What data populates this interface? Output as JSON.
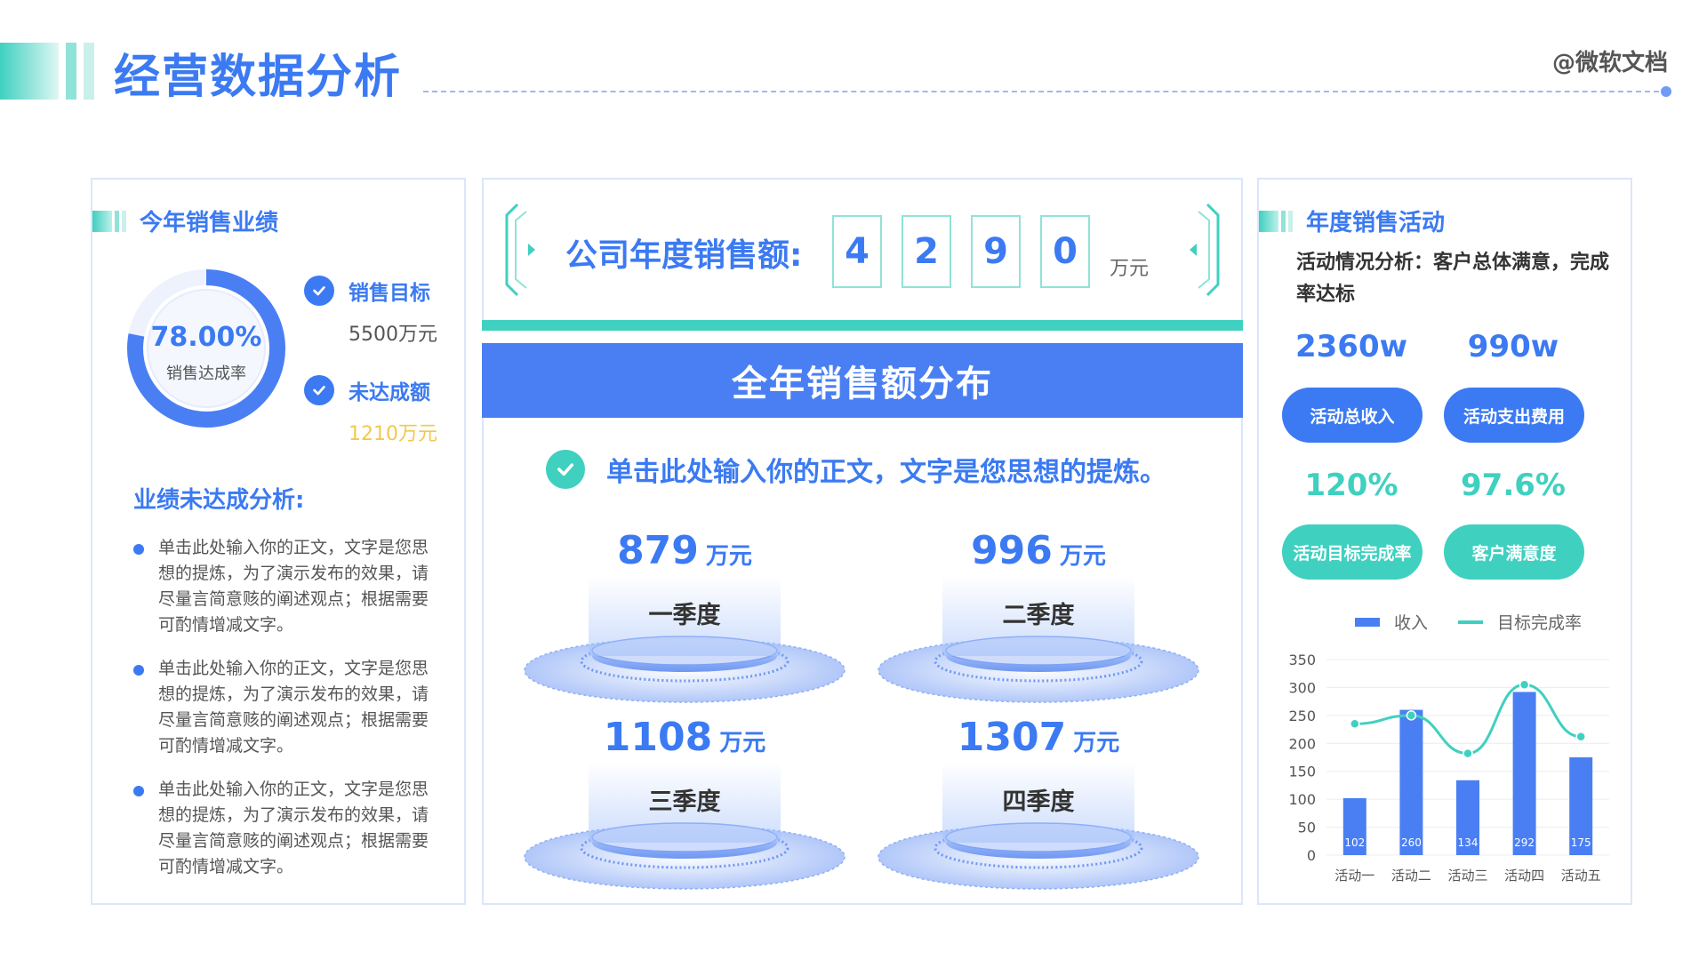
{
  "header": {
    "title": "经营数据分析",
    "brand": "@微软文档"
  },
  "left": {
    "section_title": "今年销售业绩",
    "donut": {
      "value_text": "78.00%",
      "label": "销售达成率",
      "fraction": 0.78
    },
    "kpis": [
      {
        "label": "销售目标",
        "value": "5500万元",
        "color": "#555555"
      },
      {
        "label": "未达成额",
        "value": "1210万元",
        "color": "#f2c94c"
      }
    ],
    "analysis_title": "业绩未达成分析:",
    "bullets": [
      "单击此处输入你的正文，文字是您思想的提炼，为了演示发布的效果，请尽量言简意赅的阐述观点；根据需要可酌情增减文字。",
      "单击此处输入你的正文，文字是您思想的提炼，为了演示发布的效果，请尽量言简意赅的阐述观点；根据需要可酌情增减文字。",
      "单击此处输入你的正文，文字是您思想的提炼，为了演示发布的效果，请尽量言简意赅的阐述观点；根据需要可酌情增减文字。"
    ]
  },
  "center": {
    "sales_label": "公司年度销售额:",
    "digits": [
      "4",
      "2",
      "9",
      "0"
    ],
    "digit_unit": "万元",
    "dist_title": "全年销售额分布",
    "intro": "单击此处输入你的正文，文字是您思想的提炼。",
    "quarters": [
      {
        "value": "879",
        "unit": "万元",
        "name": "一季度"
      },
      {
        "value": "996",
        "unit": "万元",
        "name": "二季度"
      },
      {
        "value": "1108",
        "unit": "万元",
        "name": "三季度"
      },
      {
        "value": "1307",
        "unit": "万元",
        "name": "四季度"
      }
    ]
  },
  "right": {
    "section_title": "年度销售活动",
    "desc": "活动情况分析：客户总体满意，完成率达标",
    "stats": [
      {
        "value": "2360w",
        "label": "活动总收入",
        "color": "#3b7af2"
      },
      {
        "value": "990w",
        "label": "活动支出费用",
        "color": "#3b7af2"
      },
      {
        "value": "120%",
        "label": "活动目标完成率",
        "color": "#3fd0c0"
      },
      {
        "value": "97.6%",
        "label": "客户满意度",
        "color": "#3fd0c0"
      }
    ]
  },
  "colors": {
    "blue": "#3b7af2",
    "bar_blue": "#4a7ff3",
    "teal": "#3fd0c0",
    "pale_blue": "#dbe6fb"
  },
  "chart_data": {
    "type": "bar",
    "categories": [
      "活动一",
      "活动二",
      "活动三",
      "活动四",
      "活动五"
    ],
    "series": [
      {
        "name": "收入",
        "type": "bar",
        "values": [
          102,
          260,
          134,
          292,
          175
        ]
      },
      {
        "name": "目标完成率",
        "type": "line",
        "values": [
          235,
          250,
          182,
          305,
          212
        ]
      }
    ],
    "ylim": [
      0,
      350
    ],
    "yticks": [
      0,
      50,
      100,
      150,
      200,
      250,
      300,
      350
    ],
    "grid": true,
    "legend": "top"
  }
}
